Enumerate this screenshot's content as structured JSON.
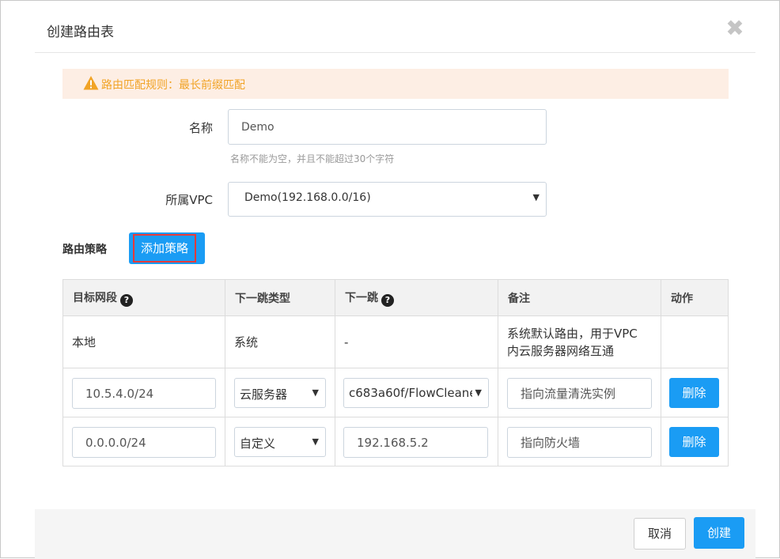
{
  "dialog": {
    "title": "创建路由表",
    "close_icon": "close-icon"
  },
  "alert": {
    "icon": "warning-icon",
    "text": "路由匹配规则：最长前缀匹配"
  },
  "form": {
    "name_label": "名称",
    "name_value": "Demo",
    "name_help": "名称不能为空，并且不能超过30个字符",
    "vpc_label": "所属VPC",
    "vpc_value": "Demo(192.168.0.0/16)"
  },
  "routes": {
    "section_label": "路由策略",
    "add_button": "添加策略",
    "columns": [
      "目标网段",
      "下一跳类型",
      "下一跳",
      "备注",
      "动作"
    ],
    "rows": [
      {
        "target": "本地",
        "hop_type": "系统",
        "next_hop": "-",
        "note_line1": "系统默认路由，用于VPC",
        "note_line2": "内云服务器网络互通"
      },
      {
        "target": "10.5.4.0/24",
        "hop_type": "云服务器",
        "next_hop": "c683a60f/FlowCleane",
        "note": "指向流量清洗实例",
        "action": "删除"
      },
      {
        "target": "0.0.0.0/24",
        "hop_type": "自定义",
        "next_hop": "192.168.5.2",
        "note": "指向防火墙",
        "action": "删除"
      }
    ]
  },
  "footer": {
    "cancel": "取消",
    "create": "创建"
  }
}
